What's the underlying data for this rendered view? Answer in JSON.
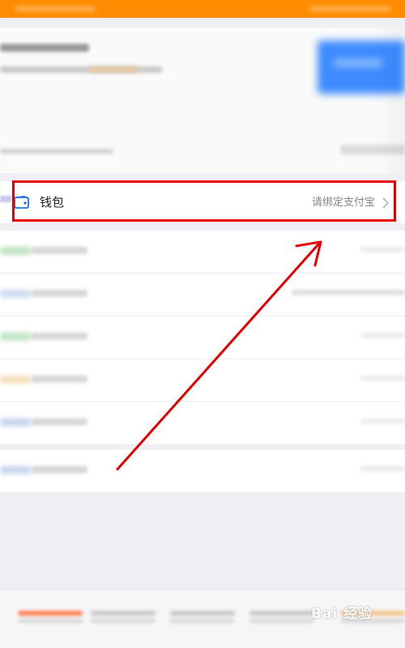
{
  "colors": {
    "header": "#ff8c00",
    "annotation": "#e60000",
    "wallet_icon": "#1a6fe8",
    "background": "#efeff4"
  },
  "wallet": {
    "label": "钱包",
    "status": "请绑定支付宝",
    "icon": "wallet-icon",
    "chevron": "chevron-right-icon"
  },
  "watermark": {
    "text": "Bai 经验"
  }
}
